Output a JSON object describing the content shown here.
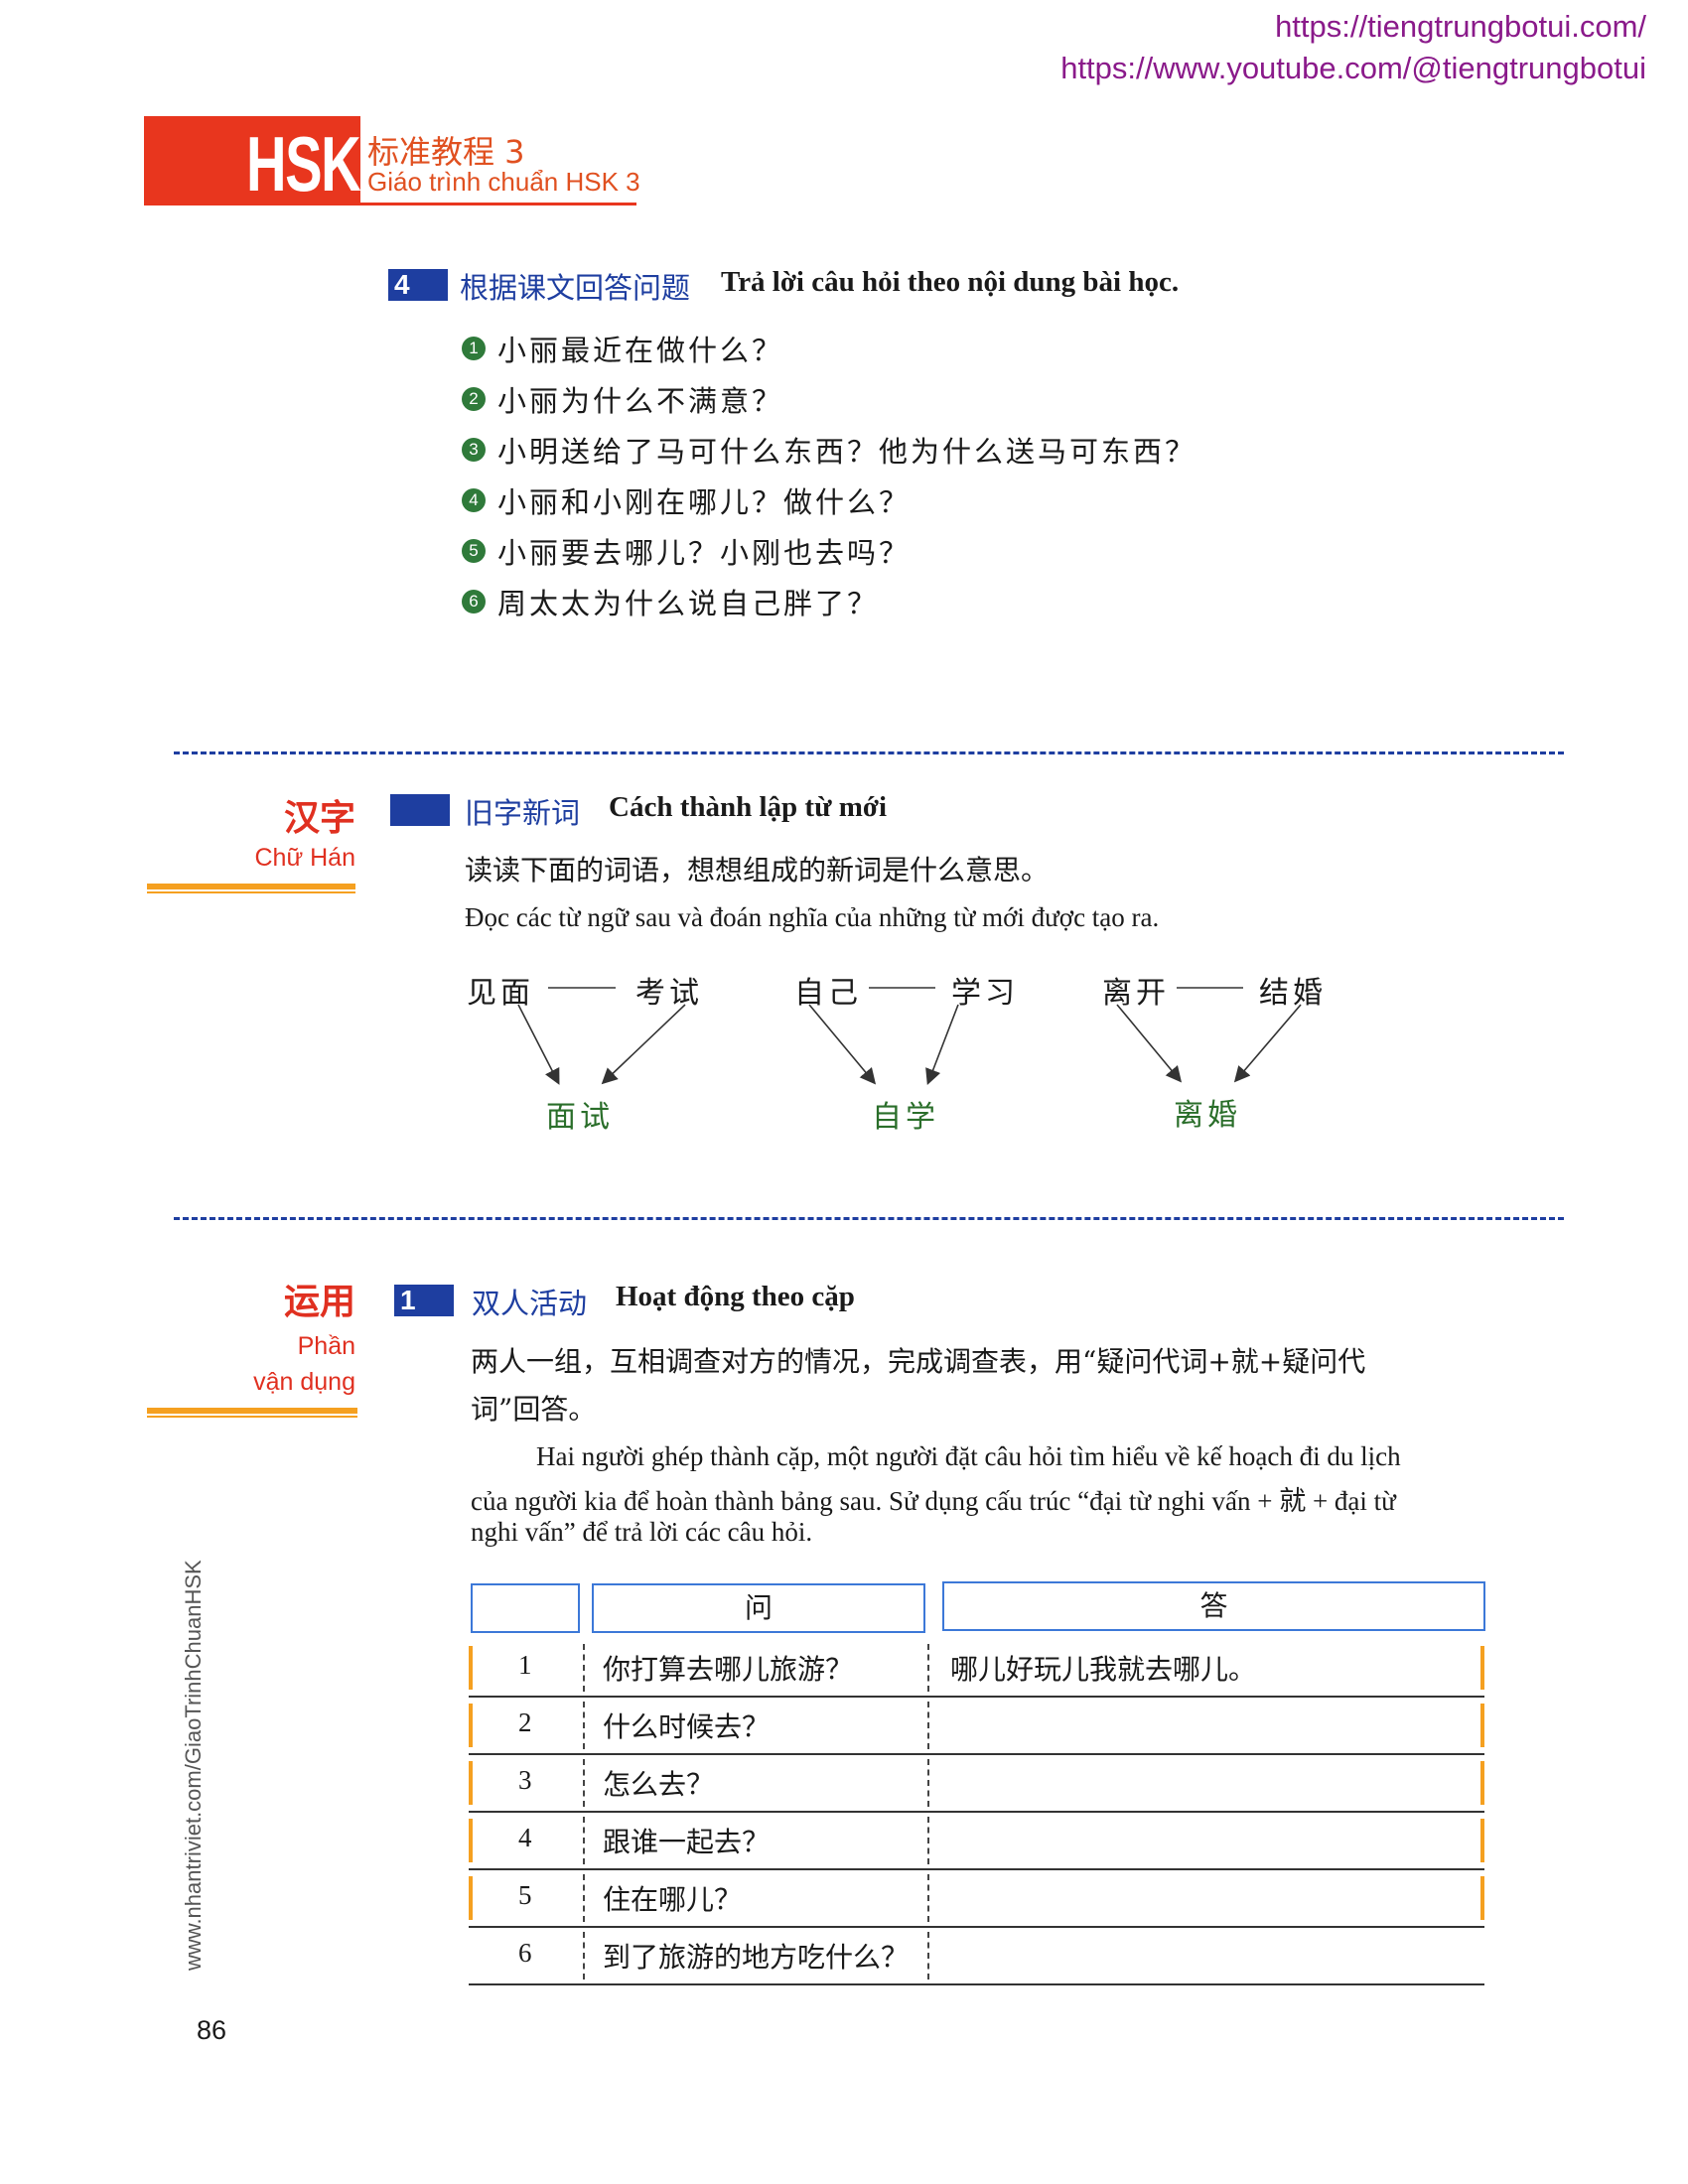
{
  "urls": [
    "https://tiengtrungbotui.com/",
    "https://www.youtube.com/@tiengtrungbotui"
  ],
  "header": {
    "logo": "HSK",
    "book_title_cn": "标准教程 3",
    "book_title_vi": "Giáo trình chuẩn HSK 3"
  },
  "section4": {
    "number": "4",
    "title_cn": "根据课文回答问题",
    "title_vi": "Trả lời câu hỏi theo nội dung bài học.",
    "questions": [
      {
        "num": "1",
        "text": "小丽最近在做什么？"
      },
      {
        "num": "2",
        "text": "小丽为什么不满意？"
      },
      {
        "num": "3",
        "text": "小明送给了马可什么东西？他为什么送马可东西？"
      },
      {
        "num": "4",
        "text": "小丽和小刚在哪儿？做什么？"
      },
      {
        "num": "5",
        "text": "小丽要去哪儿？小刚也去吗？"
      },
      {
        "num": "6",
        "text": "周太太为什么说自己胖了？"
      }
    ]
  },
  "hanzi": {
    "side_cn": "汉字",
    "side_vi": "Chữ Hán",
    "title_cn": "旧字新词",
    "title_vi": "Cách thành lập từ mới",
    "instruction_cn": "读读下面的词语，想想组成的新词是什么意思。",
    "instruction_vi": "Đọc các từ ngữ sau và đoán nghĩa của những từ mới được tạo ra.",
    "groups": [
      {
        "left": "见面",
        "right": "考试",
        "result": "面试"
      },
      {
        "left": "自己",
        "right": "学习",
        "result": "自学"
      },
      {
        "left": "离开",
        "right": "结婚",
        "result": "离婚"
      }
    ]
  },
  "yunyong": {
    "side_cn": "运用",
    "side_vi_1": "Phần",
    "side_vi_2": "vận dụng",
    "number": "1",
    "title_cn": "双人活动",
    "title_vi": "Hoạt động theo cặp",
    "instruction_cn_1": "两人一组，互相调查对方的情况，完成调查表，用“疑问代词+就+疑问代",
    "instruction_cn_2": "词”回答。",
    "instruction_vi_1": "Hai người ghép thành cặp, một người đặt câu hỏi tìm hiểu về kế hoạch đi du lịch",
    "instruction_vi_2": "của người kia để hoàn thành bảng sau. Sử dụng cấu trúc “đại từ nghi vấn + 就 + đại từ",
    "instruction_vi_3": "nghi vấn” để trả lời các câu hỏi.",
    "table": {
      "col_ask": "问",
      "col_answer": "答",
      "rows": [
        {
          "num": "1",
          "q": "你打算去哪儿旅游？",
          "a": "哪儿好玩儿我就去哪儿。"
        },
        {
          "num": "2",
          "q": "什么时候去？",
          "a": ""
        },
        {
          "num": "3",
          "q": "怎么去？",
          "a": ""
        },
        {
          "num": "4",
          "q": "跟谁一起去？",
          "a": ""
        },
        {
          "num": "5",
          "q": "住在哪儿？",
          "a": ""
        },
        {
          "num": "6",
          "q": "到了旅游的地方吃什么？",
          "a": ""
        }
      ]
    }
  },
  "footer": {
    "vertical_url": "www.nhantriviet.com/GiaoTrinhChuanHSK",
    "page": "86"
  }
}
